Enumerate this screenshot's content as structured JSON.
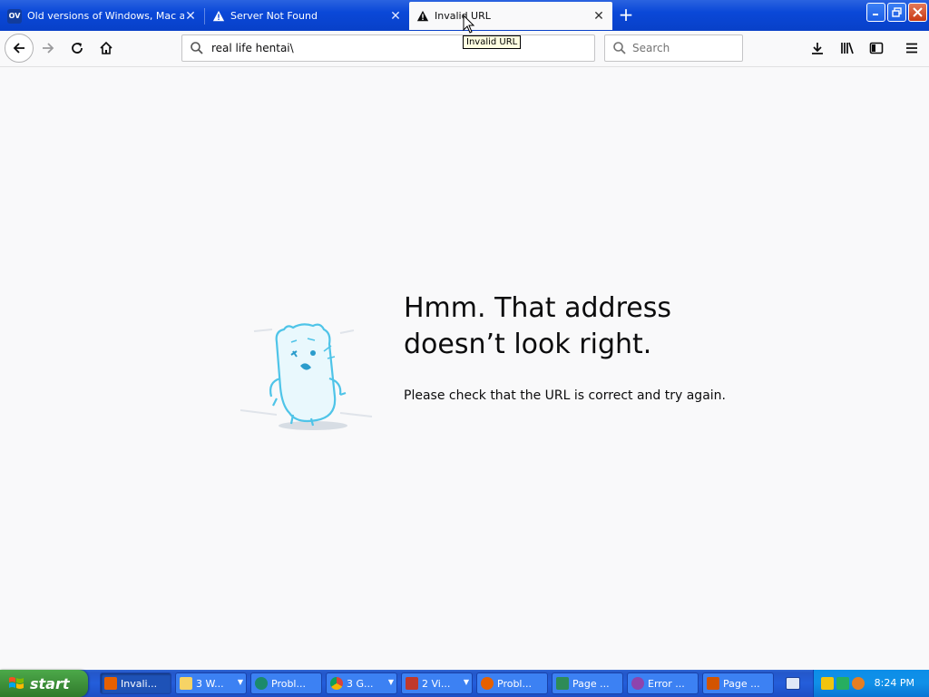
{
  "browser": {
    "tabs": [
      {
        "title": "Old versions of Windows, Mac and",
        "favicon": "ov-favicon",
        "active": false
      },
      {
        "title": "Server Not Found",
        "favicon": "warning-icon",
        "active": false
      },
      {
        "title": "Invalid URL",
        "favicon": "warning-icon",
        "active": true
      }
    ],
    "tooltip": "Invalid URL",
    "url": "real life hentai\\",
    "search_placeholder": "Search"
  },
  "error_page": {
    "heading_line1": "Hmm. That address",
    "heading_line2": "doesn’t look right.",
    "message": "Please check that the URL is correct and try again."
  },
  "taskbar": {
    "start_label": "start",
    "tasks": [
      {
        "label": "Invali...",
        "icon": "firefox-icon",
        "active": true,
        "group": false
      },
      {
        "label": "3 W...",
        "icon": "folder-icon",
        "active": false,
        "group": true
      },
      {
        "label": "Probl...",
        "icon": "netscape-icon",
        "active": false,
        "group": false
      },
      {
        "label": "3 G...",
        "icon": "chrome-icon",
        "active": false,
        "group": true
      },
      {
        "label": "2 Vi...",
        "icon": "viewer-icon",
        "active": false,
        "group": true
      },
      {
        "label": "Probl...",
        "icon": "firefox-icon",
        "active": false,
        "group": false
      },
      {
        "label": "Page ...",
        "icon": "seamonkey-icon",
        "active": false,
        "group": false
      },
      {
        "label": "Error ...",
        "icon": "opera-icon",
        "active": false,
        "group": false
      },
      {
        "label": "Page ...",
        "icon": "grid-icon",
        "active": false,
        "group": false
      }
    ],
    "clock": "8:24 PM"
  },
  "colors": {
    "xp_blue": "#0a48d8",
    "start_green": "#3c8c38",
    "page_bg": "#f9f9fa"
  }
}
